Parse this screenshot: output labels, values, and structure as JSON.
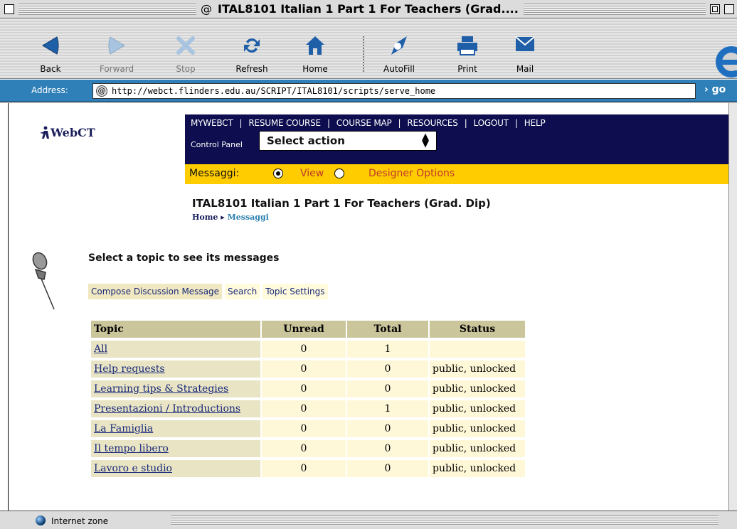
{
  "window": {
    "title": "ITAL8101 Italian 1 Part 1 For Teachers (Grad...."
  },
  "toolbar": {
    "buttons": [
      {
        "label": "Back",
        "icon": "back-arrow-icon"
      },
      {
        "label": "Forward",
        "icon": "forward-arrow-icon"
      },
      {
        "label": "Stop",
        "icon": "stop-icon"
      },
      {
        "label": "Refresh",
        "icon": "refresh-icon"
      },
      {
        "label": "Home",
        "icon": "home-icon"
      },
      {
        "label": "AutoFill",
        "icon": "autofill-icon"
      },
      {
        "label": "Print",
        "icon": "printer-icon"
      },
      {
        "label": "Mail",
        "icon": "mail-icon"
      }
    ]
  },
  "address": {
    "label": "Address:",
    "url": "http://webct.flinders.edu.au/SCRIPT/ITAL8101/scripts/serve_home",
    "go": "go"
  },
  "webct": {
    "logo": "WebCT",
    "nav": [
      "MYWEBCT",
      "RESUME COURSE",
      "COURSE MAP",
      "RESOURCES",
      "LOGOUT",
      "HELP"
    ],
    "control_panel": "Control Panel",
    "select_action": "Select action"
  },
  "messaggi": {
    "label": "Messaggi:",
    "view": "View",
    "designer": "Designer Options"
  },
  "course": {
    "title": "ITAL8101 Italian 1 Part 1 For Teachers (Grad. Dip)",
    "breadcrumb_home": "Home",
    "breadcrumb_current": "Messaggi"
  },
  "main": {
    "heading": "Select a topic to see its messages",
    "actions": [
      "Compose Discussion Message",
      "Search",
      "Topic Settings"
    ]
  },
  "table": {
    "headers": [
      "Topic",
      "Unread",
      "Total",
      "Status"
    ],
    "rows": [
      {
        "topic": "All",
        "unread": "0",
        "total": "1",
        "status": ""
      },
      {
        "topic": "Help requests",
        "unread": "0",
        "total": "0",
        "status": "public, unlocked"
      },
      {
        "topic": "Learning tips & Strategies",
        "unread": "0",
        "total": "0",
        "status": "public, unlocked"
      },
      {
        "topic": "Presentazioni / Introductions",
        "unread": "0",
        "total": "1",
        "status": "public, unlocked"
      },
      {
        "topic": "La Famiglia",
        "unread": "0",
        "total": "0",
        "status": "public, unlocked"
      },
      {
        "topic": "Il tempo libero",
        "unread": "0",
        "total": "0",
        "status": "public, unlocked"
      },
      {
        "topic": "Lavoro e studio",
        "unread": "0",
        "total": "0",
        "status": "public, unlocked"
      }
    ]
  },
  "status": {
    "zone": "Internet zone"
  }
}
